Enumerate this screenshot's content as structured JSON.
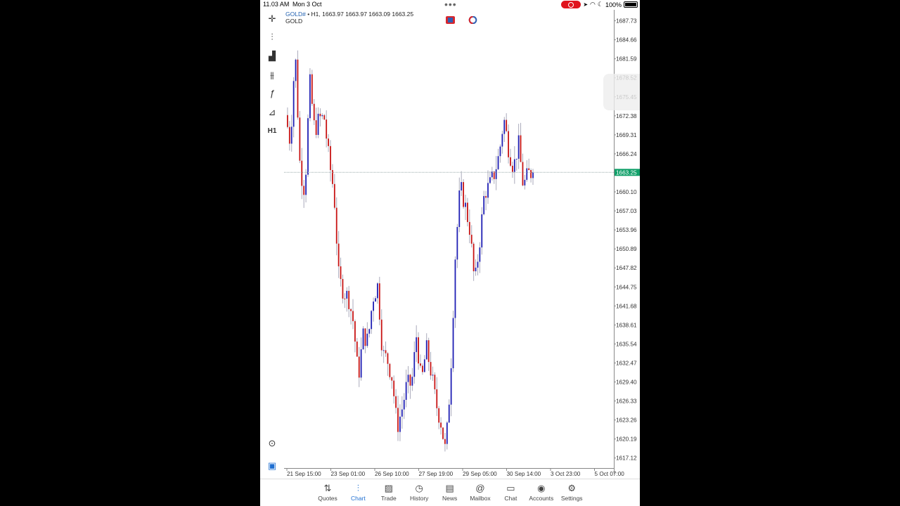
{
  "status_bar": {
    "time": "11.03 AM",
    "date": "Mon 3 Oct",
    "battery": "100%"
  },
  "chart_header": {
    "symbol": "GOLD#",
    "info": " • H1, 1663.97 1663.97 1663.09 1663.25",
    "description": "GOLD"
  },
  "colors": {
    "bull": "#1f1fb4",
    "bear": "#c81414",
    "last_price_bg": "#12a06a",
    "accent": "#1f6fd1"
  },
  "toolbar": [
    {
      "name": "crosshair-icon",
      "glyph": "✛"
    },
    {
      "name": "chart-type-icon",
      "glyph": "⫶"
    },
    {
      "name": "indicators-icon",
      "glyph": "▟"
    },
    {
      "name": "objects-icon",
      "glyph": "⫵"
    },
    {
      "name": "function-icon",
      "glyph": "ƒ"
    },
    {
      "name": "shapes-icon",
      "glyph": "⊿"
    },
    {
      "name": "timeframe-button",
      "glyph": "H1"
    }
  ],
  "tabs": [
    {
      "label": "Quotes",
      "icon": "⇅",
      "name": "tab-quotes"
    },
    {
      "label": "Chart",
      "icon": "⫶",
      "name": "tab-chart",
      "active": true
    },
    {
      "label": "Trade",
      "icon": "▨",
      "name": "tab-trade"
    },
    {
      "label": "History",
      "icon": "◷",
      "name": "tab-history"
    },
    {
      "label": "News",
      "icon": "▤",
      "name": "tab-news"
    },
    {
      "label": "Mailbox",
      "icon": "@",
      "name": "tab-mailbox"
    },
    {
      "label": "Chat",
      "icon": "▭",
      "name": "tab-chat"
    },
    {
      "label": "Accounts",
      "icon": "◉",
      "name": "tab-accounts"
    },
    {
      "label": "Settings",
      "icon": "⚙",
      "name": "tab-settings"
    }
  ],
  "chart_data": {
    "type": "candlestick",
    "symbol": "GOLD#",
    "timeframe": "H1",
    "last_price": "1663.25",
    "y_ticks": [
      "1687.73",
      "1684.66",
      "1681.59",
      "1678.52",
      "1675.45",
      "1672.38",
      "1669.31",
      "1666.24",
      "1663.17",
      "1660.10",
      "1657.03",
      "1653.96",
      "1650.89",
      "1647.82",
      "1644.75",
      "1641.68",
      "1638.61",
      "1635.54",
      "1632.47",
      "1629.40",
      "1626.33",
      "1623.26",
      "1620.19",
      "1617.12"
    ],
    "x_ticks": [
      "21 Sep 15:00",
      "23 Sep 01:00",
      "26 Sep 10:00",
      "27 Sep 19:00",
      "29 Sep 05:00",
      "30 Sep 14:00",
      "3 Oct 23:00",
      "5 Oct 07:00"
    ],
    "ylim": [
      1615.5,
      1689.5
    ],
    "close_path": [
      1672.5,
      1668,
      1683,
      1664,
      1660,
      1678,
      1670,
      1672,
      1672,
      1665,
      1660,
      1646,
      1644,
      1643,
      1639,
      1630,
      1637,
      1636,
      1643,
      1645,
      1634,
      1633,
      1630,
      1622,
      1625,
      1629,
      1629,
      1637,
      1629,
      1635,
      1631,
      1626,
      1623,
      1618,
      1630,
      1650,
      1661,
      1658,
      1654,
      1645,
      1652,
      1660,
      1661,
      1663,
      1666,
      1672,
      1667,
      1664,
      1668,
      1661,
      1663,
      1663.25
    ]
  }
}
